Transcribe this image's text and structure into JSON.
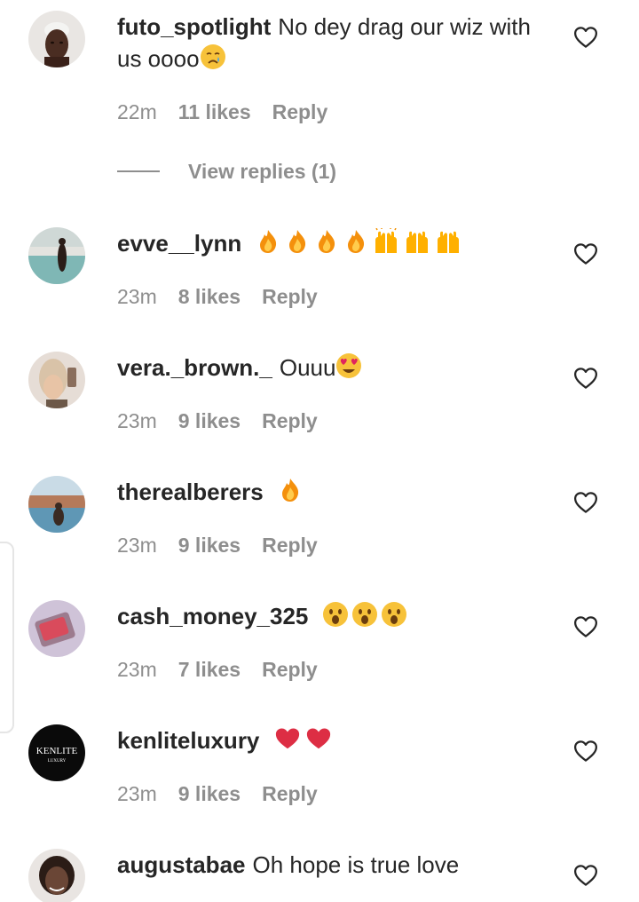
{
  "comments": [
    {
      "username": "futo_spotlight",
      "text": "No dey drag our wiz with us oooo",
      "emoji": [
        "crying-face"
      ],
      "time": "22m",
      "likes": "11 likes",
      "reply": "Reply",
      "view_replies": "View replies (1)"
    },
    {
      "username": "evve__lynn",
      "text": "",
      "emoji": [
        "fire",
        "fire",
        "fire",
        "fire",
        "raising-hands",
        "raising-hands",
        "raising-hands"
      ],
      "time": "23m",
      "likes": "8 likes",
      "reply": "Reply"
    },
    {
      "username": "vera._brown._",
      "text": "Ouuu",
      "emoji": [
        "heart-eyes"
      ],
      "time": "23m",
      "likes": "9 likes",
      "reply": "Reply"
    },
    {
      "username": "therealberers",
      "text": "",
      "emoji": [
        "fire"
      ],
      "time": "23m",
      "likes": "9 likes",
      "reply": "Reply"
    },
    {
      "username": "cash_money_325",
      "text": "",
      "emoji": [
        "surprised-face",
        "surprised-face",
        "surprised-face"
      ],
      "time": "23m",
      "likes": "7 likes",
      "reply": "Reply"
    },
    {
      "username": "kenliteluxury",
      "text": "",
      "emoji": [
        "red-heart",
        "red-heart"
      ],
      "time": "23m",
      "likes": "9 likes",
      "reply": "Reply",
      "avatar_logo": "KENLITE",
      "avatar_logo_sub": "LUXURY"
    },
    {
      "username": "augustabae",
      "text": "Oh hope is true love",
      "emoji": []
    }
  ],
  "colors": {
    "text": "#262626",
    "muted": "#8e8e8e",
    "heart_outline": "#262626"
  }
}
